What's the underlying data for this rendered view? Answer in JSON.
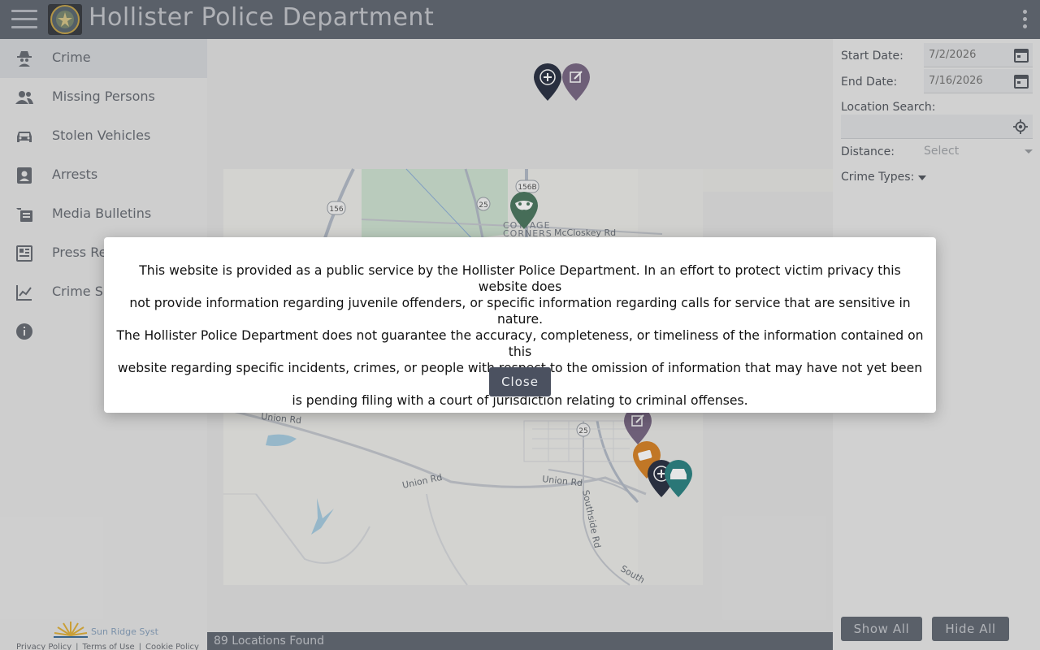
{
  "header": {
    "title": "Hollister Police Department",
    "menu_icon": "hamburger-menu-icon",
    "more_icon": "kebab-menu-icon"
  },
  "sidebar": {
    "items": [
      {
        "label": "Crime",
        "icon": "spy-icon",
        "active": true
      },
      {
        "label": "Missing Persons",
        "icon": "people-icon"
      },
      {
        "label": "Stolen Vehicles",
        "icon": "car-icon"
      },
      {
        "label": "Arrests",
        "icon": "badge-icon"
      },
      {
        "label": "Media Bulletins",
        "icon": "bulletin-icon"
      },
      {
        "label": "Press Re",
        "icon": "newspaper-icon"
      },
      {
        "label": "Crime S",
        "icon": "chart-icon"
      },
      {
        "label": "",
        "icon": "info-icon"
      }
    ],
    "footer": {
      "brand": "Sun Ridge Syst",
      "links": [
        "Privacy Policy",
        "Terms of Use",
        "Cookie Policy"
      ]
    }
  },
  "map": {
    "labels": {
      "route_156": "156",
      "route_156b": "156B",
      "route_25": "25",
      "route_25b": "25",
      "cottage": "COTTAGE",
      "corners": "CORNERS",
      "mccloskey": "McCloskey Rd",
      "union_rd_1": "Union Rd",
      "union_rd_2": "Union Rd",
      "union_rd_3": "Union Rd",
      "southside": "Southside Rd",
      "south": "South"
    },
    "status": "89 Locations Found"
  },
  "filters": {
    "start_label": "Start Date:",
    "start_value": "7/2/2026",
    "end_label": "End Date:",
    "end_value": "7/16/2026",
    "location_label": "Location Search:",
    "location_value": "",
    "distance_label": "Distance:",
    "distance_placeholder": "Select",
    "crime_types_label": "Crime Types:",
    "show_all": "Show All",
    "hide_all": "Hide All"
  },
  "modal": {
    "lines": [
      "This website is provided as a public service by the Hollister Police Department. In an effort to protect victim privacy this website does",
      "not provide information regarding juvenile offenders, or specific information regarding calls for service that are sensitive in nature.",
      "The Hollister Police Department does not guarantee the accuracy, completeness, or timeliness of the information contained on this",
      "website regarding specific incidents, crimes, or people with respect to the omission of information that may have not yet been filed or",
      "is pending filing with a court of jurisdiction relating to criminal offenses."
    ],
    "close_label": "Close"
  },
  "colors": {
    "header": "#656b75",
    "modal_button": "#4b5160",
    "pin_navy": "#2e3547",
    "pin_purple": "#7b6a86",
    "pin_green": "#4f7a63",
    "pin_orange": "#d7852b",
    "pin_teal": "#2f8585"
  }
}
